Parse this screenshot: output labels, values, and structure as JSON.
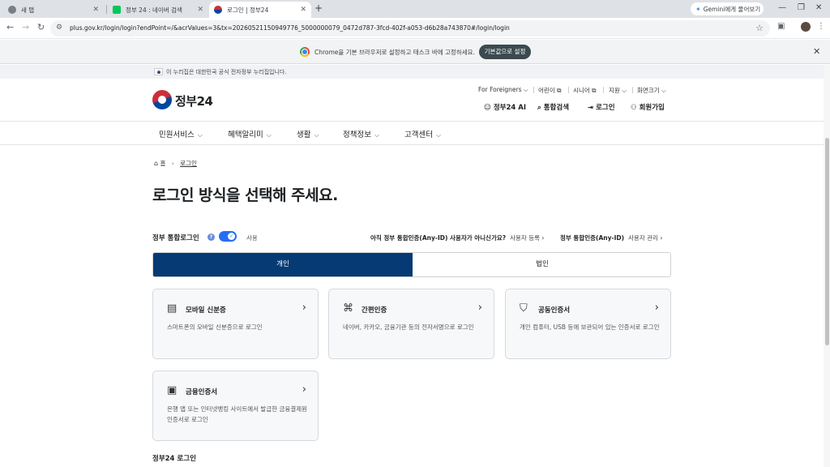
{
  "browser": {
    "tabs": [
      {
        "title": "새 탭"
      },
      {
        "title": "정부 24 : 네이버 검색"
      },
      {
        "title": "로그인 | 정부24"
      }
    ],
    "new_tab": "+",
    "gemini_label": "Gemini에게 물어보기",
    "url": "plus.gov.kr/login/login?endPoint=/&acrValues=3&tx=20260521150949776_5000000079_0472d787-3fcd-402f-a053-d6b28a743870#/login/login",
    "infobar_text": "Chrome을 기본 브라우저로 설정하고 태스크 바에 고정하세요.",
    "infobar_button": "기본값으로 설정"
  },
  "gov_banner": "이 누리집은 대한민국 공식 전자정부 누리집입니다.",
  "header": {
    "logo_text": "정부",
    "logo_number": "24",
    "util": [
      {
        "label": "For Foreigners",
        "glyph": "⌵"
      },
      {
        "label": "어린이",
        "glyph": "⧉"
      },
      {
        "label": "시니어",
        "glyph": "⧉"
      },
      {
        "label": "지원",
        "glyph": "⌵"
      },
      {
        "label": "화면크기",
        "glyph": "⌵"
      }
    ],
    "actions": [
      {
        "label": "정부24 AI",
        "icon": "robot-icon"
      },
      {
        "label": "통합검색",
        "icon": "search-icon"
      },
      {
        "label": "로그인",
        "icon": "login-icon"
      },
      {
        "label": "회원가입",
        "icon": "user-plus-icon"
      }
    ]
  },
  "gnb": [
    "민원서비스",
    "혜택알리미",
    "생활",
    "정책정보",
    "고객센터"
  ],
  "breadcrumb": {
    "home": "홈",
    "current": "로그인"
  },
  "page_title": "로그인 방식을 선택해 주세요.",
  "options": {
    "integrated_label": "정부 통합로그인",
    "toggle_state": "사용",
    "register_question": "아직 정부 통합인증(Any-ID) 사용자가 아니신가요?",
    "register_action": "사용자 등록",
    "manage_label": "정부 통합인증(Any-ID)",
    "manage_action": "사용자 관리"
  },
  "segments": {
    "personal": "개인",
    "corporate": "법인"
  },
  "cards": [
    {
      "title": "모바일 신분증",
      "desc": "스마트폰의 모바일 신분증으로 로그인",
      "icon": "id-card-icon"
    },
    {
      "title": "간편인증",
      "desc": "네이버, 카카오, 금융기관 등의 전자서명으로 로그인",
      "icon": "simple-auth-icon"
    },
    {
      "title": "공동인증서",
      "desc": "개인 컴퓨터, USB 등에 보관되어 있는 인증서로 로그인",
      "icon": "shield-icon"
    },
    {
      "title": "금융인증서",
      "desc": "은행 앱 또는 인터넷뱅킹 사이트에서 발급한 금융결제원 인증서로 로그인",
      "icon": "certificate-icon"
    }
  ],
  "section_title": "정부24 로그인",
  "colors": {
    "primary": "#063a74",
    "toggle": "#256ef4",
    "card_bg": "#f7f8f9"
  }
}
